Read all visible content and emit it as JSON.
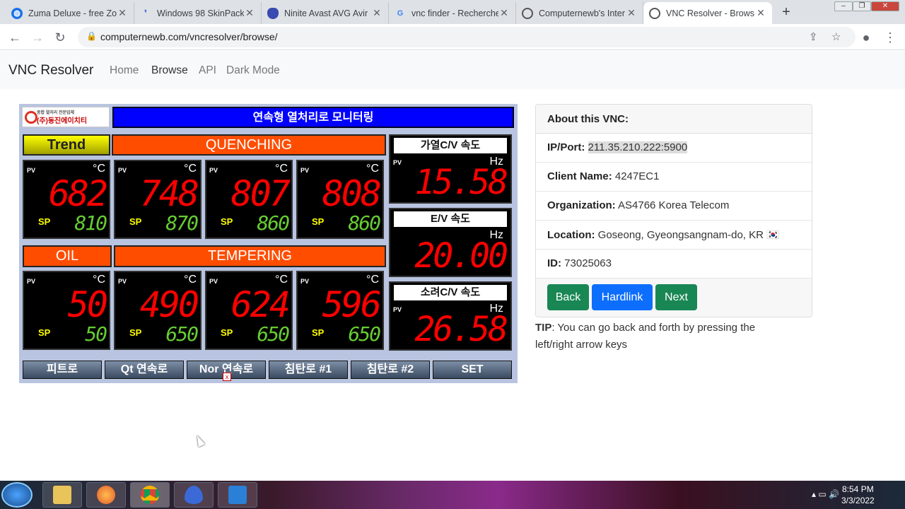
{
  "browser": {
    "tabs": [
      {
        "title": "Zuma Deluxe - free Zo",
        "fav": "globe-icon",
        "color": "#1a73e8"
      },
      {
        "title": "Windows 98 SkinPack",
        "fav": "feather-icon",
        "color": "#4a6cd4"
      },
      {
        "title": "Ninite Avast AVG Avir",
        "fav": "ninite-icon",
        "color": "#3b4ab0"
      },
      {
        "title": "vnc finder - Recherche",
        "fav": "google-icon",
        "color": "#4285f4"
      },
      {
        "title": "Computernewb's Inter",
        "fav": "computernewb-icon",
        "color": "#555"
      },
      {
        "title": "VNC Resolver - Brows",
        "fav": "computernewb-icon",
        "color": "#555"
      }
    ],
    "new_tab": "+",
    "url": "computernewb.com/vncresolver/browse/",
    "window_controls": [
      "–",
      "❐",
      "✕"
    ]
  },
  "site": {
    "brand": "VNC Resolver",
    "nav": [
      "Home",
      "Browse",
      "API",
      "Dark Mode"
    ]
  },
  "vnc_screen": {
    "company": "(주)동진에이치티",
    "company_small": "종합 열처리 전문업체",
    "title": "연속형 열처리로 모니터링",
    "trend_button": "Trend",
    "sections": {
      "quenching": "QUENCHING",
      "oil": "OIL",
      "tempering": "TEMPERING"
    },
    "pv_label": "PV",
    "sp_label": "SP",
    "deg_unit": "°C",
    "hz_unit": "Hz",
    "quench_panels": [
      {
        "pv": "682",
        "sp": "810"
      },
      {
        "pv": "748",
        "sp": "870"
      },
      {
        "pv": "807",
        "sp": "860"
      },
      {
        "pv": "808",
        "sp": "860"
      }
    ],
    "oil_panel": {
      "pv": "50",
      "sp": "50"
    },
    "temper_panels": [
      {
        "pv": "490",
        "sp": "650"
      },
      {
        "pv": "624",
        "sp": "650"
      },
      {
        "pv": "596",
        "sp": "650"
      }
    ],
    "speeds": [
      {
        "label": "가열C/V 속도",
        "value": "15.58"
      },
      {
        "label": "E/V 속도",
        "value": "20.00"
      },
      {
        "label": "소려C/V 속도",
        "value": "26.58"
      }
    ],
    "bottom_buttons": [
      "피트로",
      "Qt 연속로",
      "Nor 연속로",
      "침탄로 #1",
      "침탄로 #2",
      "SET"
    ]
  },
  "about": {
    "heading": "About this VNC:",
    "ip_label": "IP/Port:",
    "ip_value": "211.35.210.222:5900",
    "client_label": "Client Name:",
    "client_value": "4247EC1",
    "org_label": "Organization:",
    "org_value": "AS4766 Korea Telecom",
    "loc_label": "Location:",
    "loc_value": "Goseong, Gyeongsangnam-do, KR",
    "flag": "🇰🇷",
    "id_label": "ID:",
    "id_value": "73025063",
    "buttons": {
      "back": "Back",
      "hardlink": "Hardlink",
      "next": "Next"
    },
    "colors": {
      "success": "#198754",
      "primary": "#0d6efd"
    }
  },
  "tip": {
    "label": "TIP",
    "text": ": You can go back and forth by pressing the left/right arrow keys"
  },
  "taskbar": {
    "time": "8:54 PM",
    "date": "3/3/2022"
  }
}
